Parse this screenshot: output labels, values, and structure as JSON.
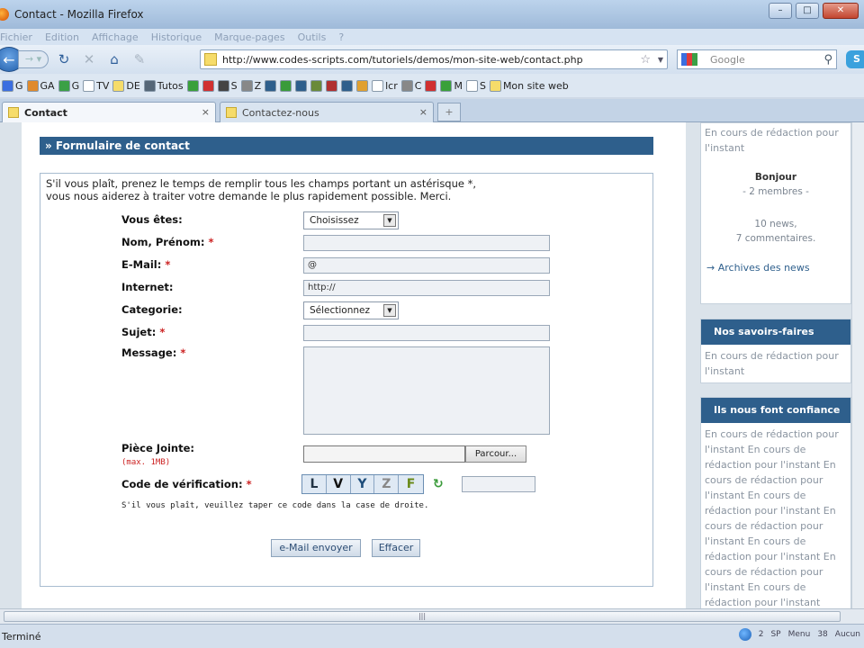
{
  "window": {
    "title": "Contact - Mozilla Firefox",
    "min": "–",
    "max": "□",
    "close": "✕"
  },
  "menu": [
    "Fichier",
    "Edition",
    "Affichage",
    "Historique",
    "Marque-pages",
    "Outils",
    "?"
  ],
  "nav": {
    "url": "http://www.codes-scripts.com/tutoriels/demos/mon-site-web/contact.php",
    "search_placeholder": "Google"
  },
  "bookmarks": [
    {
      "label": "G",
      "color": "#3b6ee0"
    },
    {
      "label": "GA",
      "color": "#e08a2c"
    },
    {
      "label": "G",
      "color": "#3ba046"
    },
    {
      "label": "TV",
      "color": "#ffffff"
    },
    {
      "label": "DE",
      "color": "#f6dc6a"
    },
    {
      "label": "Tutos",
      "color": "#556677"
    },
    {
      "label": "",
      "color": "#3aa03a"
    },
    {
      "label": "",
      "color": "#d03030"
    },
    {
      "label": "S",
      "color": "#444444"
    },
    {
      "label": "Z",
      "color": "#888888"
    },
    {
      "label": "",
      "color": "#2e5f8c"
    },
    {
      "label": "",
      "color": "#3a9b3a"
    },
    {
      "label": "",
      "color": "#2e5f8c"
    },
    {
      "label": "",
      "color": "#6a8a3a"
    },
    {
      "label": "",
      "color": "#b03030"
    },
    {
      "label": "",
      "color": "#2e5f8c"
    },
    {
      "label": "",
      "color": "#e0a030"
    },
    {
      "label": "lcr",
      "color": "#ffffff"
    },
    {
      "label": "C",
      "color": "#888888"
    },
    {
      "label": "",
      "color": "#d03030"
    },
    {
      "label": "M",
      "color": "#3aa03a"
    },
    {
      "label": "S",
      "color": "#ffffff"
    },
    {
      "label": "Mon site web",
      "color": "#f6dc6a"
    }
  ],
  "tabs": [
    {
      "label": "Contact",
      "close": "×"
    },
    {
      "label": "Contactez-nous",
      "close": "×"
    }
  ],
  "newtab": "+",
  "form": {
    "section_title": "» Formulaire de contact",
    "intro_line1": "S'il vous plaît, prenez le temps de remplir tous les champs portant un astérisque *,",
    "intro_line2": "vous nous aiderez à traiter votre demande le plus rapidement possible. Merci.",
    "fields": {
      "vous_etes": "Vous êtes:",
      "nom": "Nom, Prénom:",
      "email": "E-Mail:",
      "internet": "Internet:",
      "categorie": "Categorie:",
      "sujet": "Sujet:",
      "message": "Message:",
      "piece_jointe": "Pièce Jointe:",
      "code": "Code de vérification:"
    },
    "required_mark": "*",
    "vous_etes_value": "Choisissez",
    "email_value": "@",
    "internet_value": "http://",
    "categorie_value": "Sélectionnez",
    "file_button": "Parcour...",
    "max_note": "(max. 1MB)",
    "captcha_chars": [
      "L",
      "V",
      "Y",
      "Z",
      "F"
    ],
    "captcha_note": "S'il vous plaît, veuillez taper ce code dans la case de droite.",
    "submit": "e-Mail envoyer",
    "reset": "Effacer"
  },
  "sidebar": {
    "top_text": "En cours de rédaction pour l'instant",
    "hello": "Bonjour",
    "members": "- 2 membres -",
    "news": "10 news,",
    "comments": "7 commentaires.",
    "archives": "→ Archives des news",
    "savoirs_title": "Nos savoirs-faires",
    "savoirs_text": "En cours de rédaction pour l'instant",
    "confiance_title": "Ils nous font confiance",
    "confiance_text": "En cours de rédaction pour l'instant En cours de rédaction pour l'instant En cours de rédaction pour l'instant En cours de rédaction pour l'instant En cours de rédaction pour l'instant En cours de rédaction pour l'instant En cours de rédaction pour l'instant En cours de rédaction pour l'instant"
  },
  "status": {
    "text": "Terminé",
    "count": "2",
    "items": [
      "SP",
      "Menu",
      "38",
      "Aucun"
    ]
  }
}
